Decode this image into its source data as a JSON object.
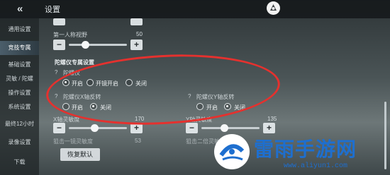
{
  "header": {
    "title": "设置",
    "back_icon": "double-chevron-left-icon",
    "avatar_icon": "character-avatar-icon"
  },
  "sidebar": {
    "items": [
      {
        "label": "通用设置",
        "active": false
      },
      {
        "label": "竞技专属",
        "active": true
      },
      {
        "label": "基础设置",
        "active": false
      },
      {
        "label": "灵敏 / 陀螺",
        "active": false
      },
      {
        "label": "操作设置",
        "active": false
      },
      {
        "label": "系统设置",
        "active": false
      },
      {
        "label": "最终12小时",
        "active": false
      },
      {
        "label": "录像设置",
        "active": false
      },
      {
        "label": "下载",
        "active": false
      }
    ]
  },
  "first_person_fov": {
    "label": "第一人称视野",
    "value": "50",
    "minus": "−",
    "plus": "+"
  },
  "gyro": {
    "section_title": "陀螺仪专属设置",
    "gyro_label": "陀螺仪",
    "gyro_options": [
      {
        "label": "开启",
        "selected": true
      },
      {
        "label": "开镜开启",
        "selected": false
      },
      {
        "label": "关闭",
        "selected": false
      }
    ],
    "x_invert_label": "陀螺仪X轴反转",
    "x_invert_options": [
      {
        "label": "开启",
        "selected": false
      },
      {
        "label": "关闭",
        "selected": true
      }
    ],
    "y_invert_label": "陀螺仪Y轴反转",
    "y_invert_options": [
      {
        "label": "开启",
        "selected": false
      },
      {
        "label": "关闭",
        "selected": true
      }
    ]
  },
  "x_sensitivity": {
    "label": "X轴灵敏度",
    "value": "170"
  },
  "y_sensitivity": {
    "label": "Y轴灵敏度",
    "value": "135"
  },
  "x_scope_row": {
    "label": "狙击一镜灵敏度",
    "value": "53"
  },
  "y_scope_row": {
    "label": "狙击二倍灵敏度"
  },
  "reset_button": {
    "label": "恢复默认"
  },
  "watermark": {
    "title": "雷雨手游网",
    "url": "www.aliyun1.com"
  }
}
